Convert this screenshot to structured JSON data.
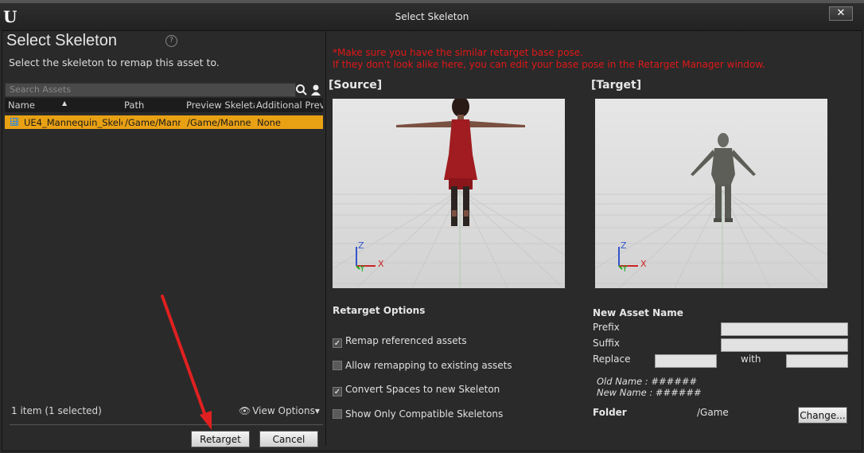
{
  "window": {
    "title": "Select Skeleton",
    "close_label": "✕",
    "logo_glyph": "U"
  },
  "left": {
    "heading": "Select Skeleton",
    "help_glyph": "?",
    "subtitle": "Select the skeleton to remap this asset to.",
    "search_placeholder": "Search Assets",
    "search_icon": "search-icon",
    "columns": [
      "Name",
      "Path",
      "Preview Skeleta",
      "Additional Prev"
    ],
    "rows": [
      {
        "name": "UE4_Mannequin_Skele",
        "path": "/Game/Mann",
        "preview": "/Game/Manne",
        "additional": "None"
      }
    ],
    "count": "1 item (1 selected)",
    "view_options": "View Options▾",
    "retarget_label": "Retarget",
    "cancel_label": "Cancel"
  },
  "right": {
    "warning_line1": "*Make sure you have the similar retarget base pose.",
    "warning_line2": "If they don't look alike here, you can edit your base pose in the Retarget Manager window.",
    "source_label": "[Source]",
    "target_label": "[Target]",
    "axis_z": "Z",
    "axis_x": "X",
    "axis_y": "Y",
    "retarget_options_title": "Retarget Options",
    "options": [
      {
        "label": "Remap referenced assets",
        "checked": true
      },
      {
        "label": "Allow remapping to existing assets",
        "checked": false
      },
      {
        "label": "Convert Spaces to new Skeleton",
        "checked": true
      },
      {
        "label": "Show Only Compatible Skeletons",
        "checked": false
      }
    ],
    "new_asset_title": "New Asset Name",
    "prefix_label": "Prefix",
    "suffix_label": "Suffix",
    "replace_label": "Replace",
    "with_label": "with",
    "old_name": "Old Name : ######",
    "new_name": "New Name : ######",
    "folder_label": "Folder",
    "folder_value": "/Game",
    "change_label": "Change..."
  },
  "colors": {
    "selection": "#e9a114",
    "warning": "#e01818",
    "annotation_arrow": "#e02020"
  }
}
